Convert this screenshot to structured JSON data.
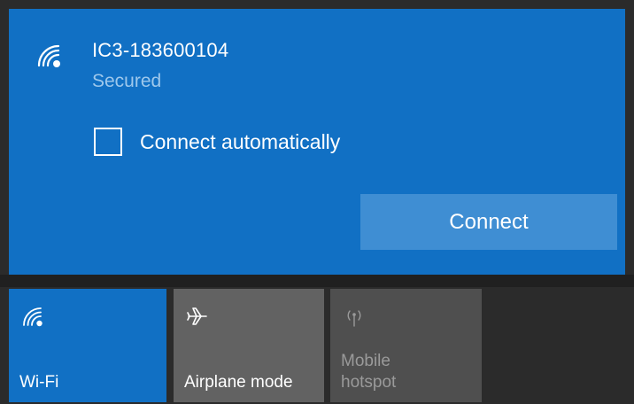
{
  "network": {
    "ssid": "IC3-183600104",
    "status": "Secured",
    "auto_connect_label": "Connect automatically",
    "auto_connect_checked": false,
    "connect_label": "Connect",
    "icon": "wifi-signal-icon"
  },
  "quick_actions": [
    {
      "label": "Wi-Fi",
      "icon": "wifi-icon",
      "active": true
    },
    {
      "label": "Airplane mode",
      "icon": "airplane-icon",
      "active": false
    },
    {
      "label_line1": "Mobile",
      "label_line2": "hotspot",
      "icon": "mobile-hotspot-icon",
      "active": false,
      "disabled": true
    }
  ],
  "colors": {
    "accent": "#1170c4",
    "button": "#3f8ed3",
    "tile_inactive": "#626262",
    "tile_disabled": "#4f4f4f",
    "background": "#2b2b2b"
  }
}
